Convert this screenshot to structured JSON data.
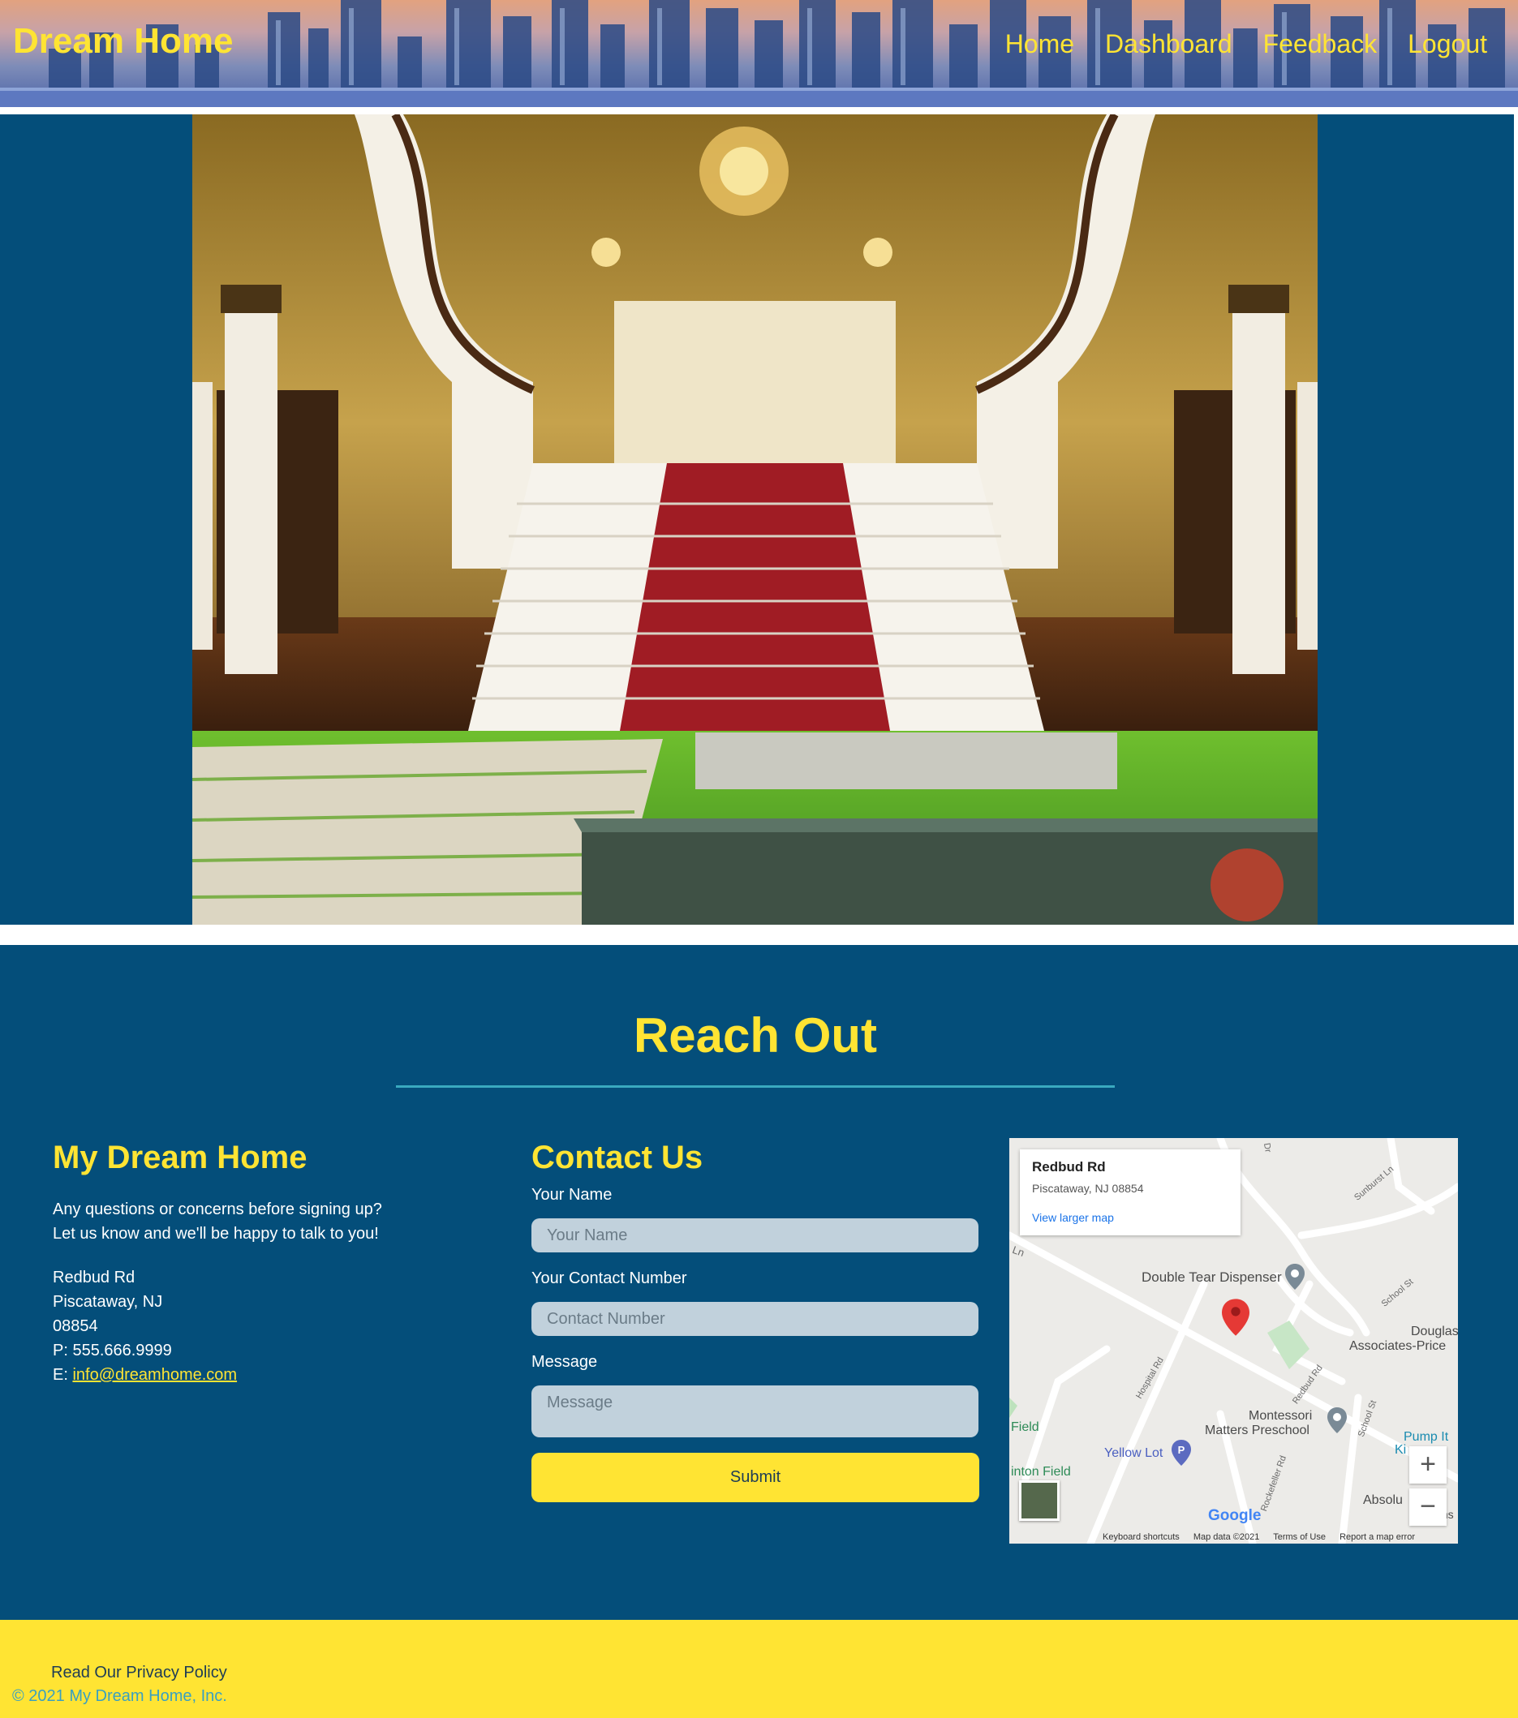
{
  "header": {
    "brand": "Dream Home",
    "nav": [
      "Home",
      "Dashboard",
      "Feedback",
      "Logout"
    ]
  },
  "contact": {
    "title": "Reach Out",
    "about": {
      "title": "My Dream Home",
      "blurb_line1": "Any questions or concerns before signing up?",
      "blurb_line2": "Let us know and we'll be happy to talk to you!",
      "street": "Redbud Rd",
      "city": "Piscataway, NJ",
      "zip": "08854",
      "phone": "P: 555.666.9999",
      "email_prefix": "E: ",
      "email": "info@dreamhome.com"
    },
    "form": {
      "title": "Contact Us",
      "name_label": "Your Name",
      "name_placeholder": "Your Name",
      "number_label": "Your Contact Number",
      "number_placeholder": "Contact Number",
      "message_label": "Message",
      "message_placeholder": "Message",
      "submit": "Submit"
    },
    "map": {
      "card_title": "Redbud Rd",
      "card_subtitle": "Piscataway, NJ 08854",
      "card_link": "View larger map",
      "places": {
        "double_tear": "Double Tear Dispenser",
        "douglas_1": "Douglas",
        "douglas_2": "Associates-Price",
        "montessori_1": "Montessori",
        "montessori_2": "Matters Preschool",
        "yellow_lot": "Yellow Lot",
        "field": "Field",
        "clinton_field": "inton Field",
        "pump_it": "Pump It",
        "ki": "Ki",
        "absolu": "Absolu",
        "systems": "Systems"
      },
      "streets": [
        "Sunburst Ln",
        "School St",
        "Hospital Rd",
        "Redbud Rd",
        "Rockefeller Rd",
        "School St",
        "Ln",
        "Dr"
      ],
      "zoom_in": "+",
      "zoom_out": "−",
      "logo": "Google",
      "footer": [
        "Keyboard shortcuts",
        "Map data ©2021",
        "Terms of Use",
        "Report a map error"
      ]
    }
  },
  "footer": {
    "privacy": "Read Our Privacy Policy",
    "copyright": "© 2021 My Dream Home, Inc."
  },
  "colors": {
    "accent_yellow": "#ffe433",
    "navy": "#044e7a",
    "teal_rule": "#3aa9bf",
    "input_bg": "#c1d1dc"
  }
}
